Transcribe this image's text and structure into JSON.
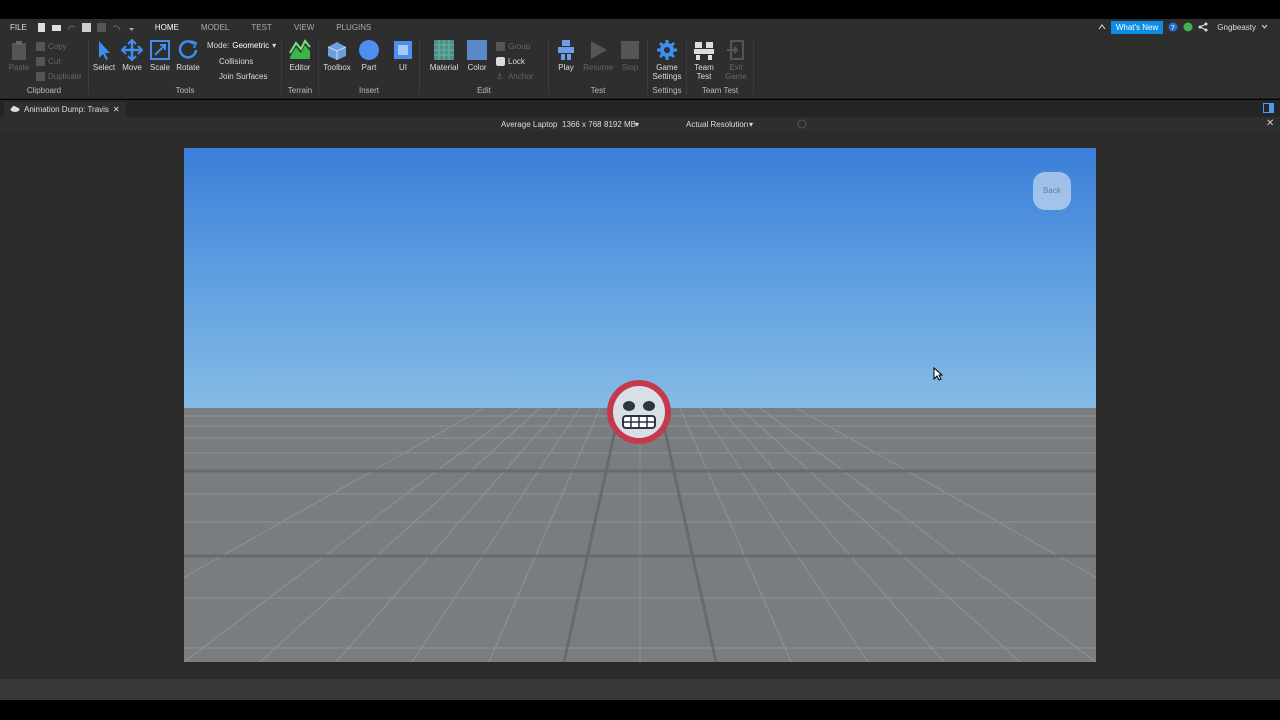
{
  "menubar": {
    "file": "FILE",
    "tabs": [
      "HOME",
      "MODEL",
      "TEST",
      "VIEW",
      "PLUGINS"
    ],
    "whats_new": "What's New",
    "username": "Gngbeasty"
  },
  "ribbon": {
    "clipboard": {
      "label": "Clipboard",
      "paste": "Paste",
      "copy": "Copy",
      "cut": "Cut",
      "duplicate": "Duplicate"
    },
    "tools": {
      "label": "Tools",
      "select": "Select",
      "move": "Move",
      "scale": "Scale",
      "rotate": "Rotate",
      "mode_label": "Mode:",
      "mode_value": "Geometric",
      "collisions": "Collisions",
      "join_surfaces": "Join Surfaces"
    },
    "terrain": {
      "label": "Terrain",
      "editor": "Editor"
    },
    "insert": {
      "label": "Insert",
      "toolbox": "Toolbox",
      "part": "Part",
      "ui": "UI"
    },
    "edit": {
      "label": "Edit",
      "material": "Material",
      "color": "Color",
      "group": "Group",
      "lock": "Lock",
      "anchor": "Anchor"
    },
    "test": {
      "label": "Test",
      "play": "Play",
      "resume": "Resume",
      "stop": "Stop"
    },
    "settings": {
      "label": "Settings",
      "game_settings_1": "Game",
      "game_settings_2": "Settings"
    },
    "team_test": {
      "label": "Team Test",
      "team_test_1": "Team",
      "team_test_2": "Test",
      "exit_1": "Exit",
      "exit_2": "Game"
    }
  },
  "document": {
    "tab_title": "Animation Dump: Travis"
  },
  "emulation": {
    "device": "Average Laptop",
    "resolution": "1366 x 768",
    "memory": "8192 MB",
    "mode": "Actual Resolution"
  },
  "viewport": {
    "back_button": "Back"
  },
  "colors": {
    "accent": "#0b8de6",
    "ribbon_bg": "#2e2e2e",
    "sky_top": "#3a7ed8",
    "sky_bottom": "#b9dae6",
    "ground": "#7a7d80"
  }
}
